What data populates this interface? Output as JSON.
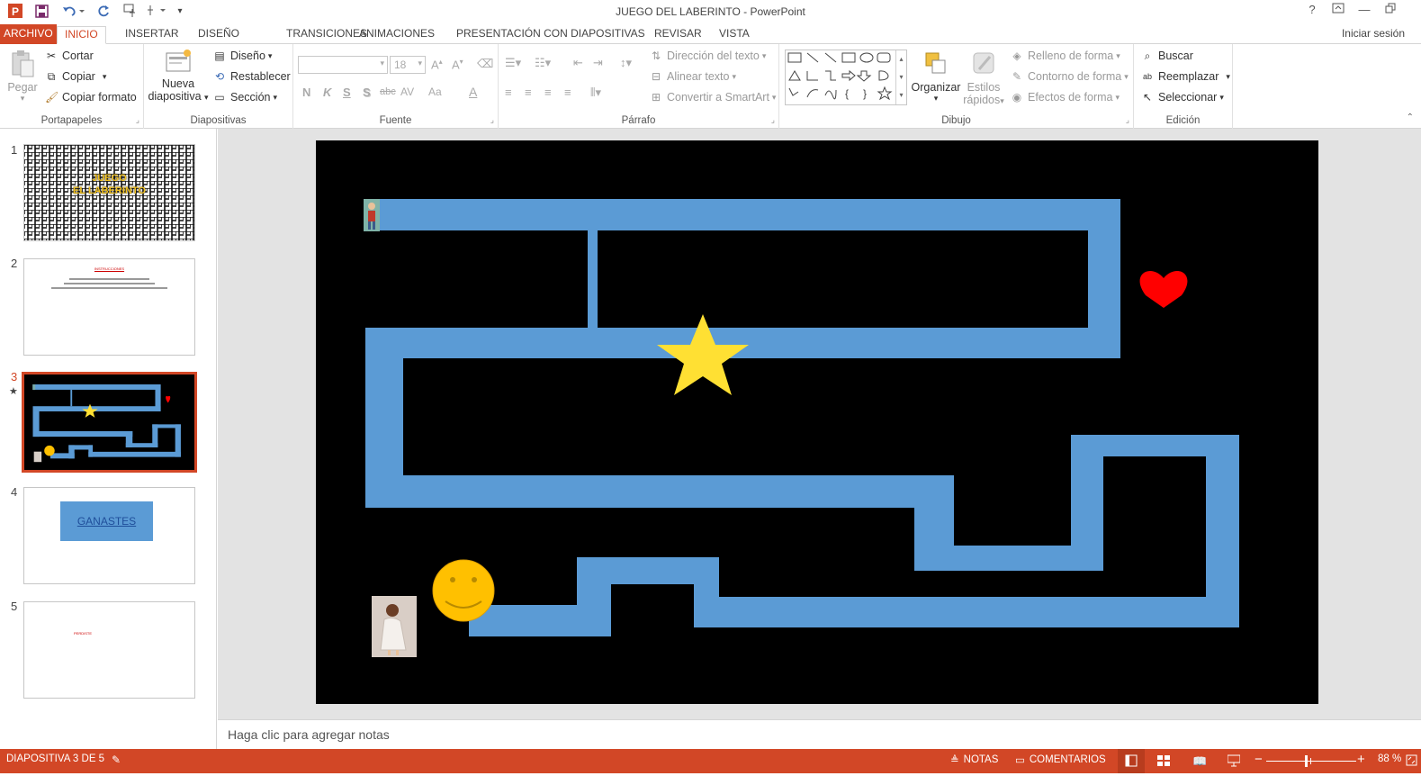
{
  "titlebar": {
    "title": "JUEGO DEL LABERINTO - PowerPoint",
    "help": "?",
    "icons": [
      "powerpoint-logo-icon",
      "save-icon",
      "undo-icon",
      "redo-icon",
      "touch-mode-icon",
      "customize-qat-icon"
    ]
  },
  "tabs": {
    "file": "ARCHIVO",
    "items": [
      "INICIO",
      "INSERTAR",
      "DISEÑO",
      "TRANSICIONES",
      "ANIMACIONES",
      "PRESENTACIÓN CON DIAPOSITIVAS",
      "REVISAR",
      "VISTA"
    ],
    "active": "INICIO",
    "signin": "Iniciar sesión"
  },
  "ribbon": {
    "portapapeles": {
      "label": "Portapapeles",
      "paste": "Pegar",
      "cut": "Cortar",
      "copy": "Copiar",
      "format": "Copiar formato"
    },
    "diapositivas": {
      "label": "Diapositivas",
      "new_line1": "Nueva",
      "new_line2": "diapositiva",
      "layout": "Diseño",
      "reset": "Restablecer",
      "section": "Sección"
    },
    "fuente": {
      "label": "Fuente",
      "size": "18",
      "bold": "N",
      "italic": "K",
      "underline": "S",
      "shadow": "S",
      "strike": "abc",
      "spacing": "AV",
      "case": "Aa",
      "color": "A"
    },
    "parrafo": {
      "label": "Párrafo",
      "direction": "Dirección del texto",
      "align": "Alinear texto",
      "smartart": "Convertir a SmartArt"
    },
    "dibujo": {
      "label": "Dibujo",
      "arrange": "Organizar",
      "styles_line1": "Estilos",
      "styles_line2": "rápidos",
      "fill": "Relleno de forma",
      "outline": "Contorno de forma",
      "effects": "Efectos de forma"
    },
    "edicion": {
      "label": "Edición",
      "find": "Buscar",
      "replace": "Reemplazar",
      "select": "Seleccionar"
    }
  },
  "slides": [
    {
      "num": "1",
      "title_line1": "JUEGO",
      "title_line2": "EL LABERINTO"
    },
    {
      "num": "2",
      "heading": "INSTRUCCIONES"
    },
    {
      "num": "3",
      "selected": true
    },
    {
      "num": "4",
      "button": "GANASTES"
    },
    {
      "num": "5",
      "text": "PERDISTE"
    }
  ],
  "notes": {
    "placeholder": "Haga clic para agregar notas"
  },
  "status": {
    "slide": "DIAPOSITIVA 3 DE 5",
    "notes": "NOTAS",
    "comments": "COMENTARIOS",
    "zoom": "88 %",
    "zoom_value": 88
  },
  "colors": {
    "accent": "#d24726",
    "maze": "#5b9bd5",
    "heart": "#ff0000",
    "star": "#ffe033",
    "smiley": "#ffc000",
    "slide_bg": "#000000"
  }
}
